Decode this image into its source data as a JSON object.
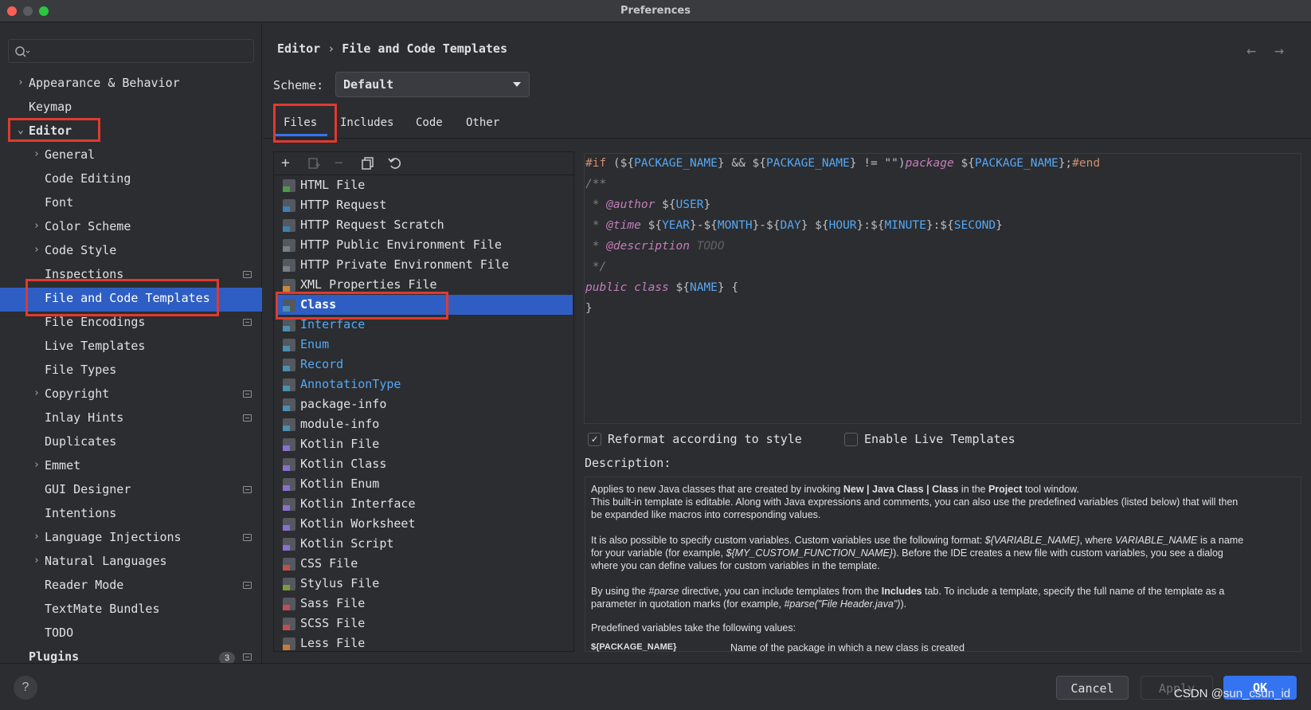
{
  "window": {
    "title": "Preferences"
  },
  "sidebar": {
    "search_placeholder": "",
    "items": [
      {
        "label": "Appearance & Behavior"
      },
      {
        "label": "Keymap"
      },
      {
        "label": "Editor"
      },
      {
        "label": "General"
      },
      {
        "label": "Code Editing"
      },
      {
        "label": "Font"
      },
      {
        "label": "Color Scheme"
      },
      {
        "label": "Code Style"
      },
      {
        "label": "Inspections"
      },
      {
        "label": "File and Code Templates"
      },
      {
        "label": "File Encodings"
      },
      {
        "label": "Live Templates"
      },
      {
        "label": "File Types"
      },
      {
        "label": "Copyright"
      },
      {
        "label": "Inlay Hints"
      },
      {
        "label": "Duplicates"
      },
      {
        "label": "Emmet"
      },
      {
        "label": "GUI Designer"
      },
      {
        "label": "Intentions"
      },
      {
        "label": "Language Injections"
      },
      {
        "label": "Natural Languages"
      },
      {
        "label": "Reader Mode"
      },
      {
        "label": "TextMate Bundles"
      },
      {
        "label": "TODO"
      },
      {
        "label": "Plugins"
      }
    ],
    "plugins_badge": "3"
  },
  "header": {
    "breadcrumb_parent": "Editor",
    "breadcrumb_sep": "›",
    "breadcrumb_current": "File and Code Templates"
  },
  "scheme": {
    "label": "Scheme:",
    "value": "Default"
  },
  "tabs": [
    {
      "label": "Files"
    },
    {
      "label": "Includes"
    },
    {
      "label": "Code"
    },
    {
      "label": "Other"
    }
  ],
  "templates": [
    {
      "label": "HTML File",
      "color": "#4b9a4b"
    },
    {
      "label": "HTTP Request",
      "color": "#3d7fb0"
    },
    {
      "label": "HTTP Request Scratch",
      "color": "#3d7fb0"
    },
    {
      "label": "HTTP Public Environment File",
      "color": "#7a7e85"
    },
    {
      "label": "HTTP Private Environment File",
      "color": "#7a7e85"
    },
    {
      "label": "XML Properties File",
      "color": "#c88a3a"
    },
    {
      "label": "Class",
      "color": "#4b8fb0"
    },
    {
      "label": "Interface",
      "color": "#4b8fb0"
    },
    {
      "label": "Enum",
      "color": "#4b8fb0"
    },
    {
      "label": "Record",
      "color": "#4b8fb0"
    },
    {
      "label": "AnnotationType",
      "color": "#4b8fb0"
    },
    {
      "label": "package-info",
      "color": "#4b8fb0"
    },
    {
      "label": "module-info",
      "color": "#4b8fb0"
    },
    {
      "label": "Kotlin File",
      "color": "#8a6fd0"
    },
    {
      "label": "Kotlin Class",
      "color": "#8a6fd0"
    },
    {
      "label": "Kotlin Enum",
      "color": "#8a6fd0"
    },
    {
      "label": "Kotlin Interface",
      "color": "#8a6fd0"
    },
    {
      "label": "Kotlin Worksheet",
      "color": "#8a6fd0"
    },
    {
      "label": "Kotlin Script",
      "color": "#8a6fd0"
    },
    {
      "label": "CSS File",
      "color": "#c0504d"
    },
    {
      "label": "Stylus File",
      "color": "#7f9a3a"
    },
    {
      "label": "Sass File",
      "color": "#c0504d"
    },
    {
      "label": "SCSS File",
      "color": "#c0504d"
    },
    {
      "label": "Less File",
      "color": "#c87a3a"
    }
  ],
  "code": {
    "l1_if": "#if",
    "l1_a": " (${",
    "l1_v1": "PACKAGE_NAME",
    "l1_b": "} && ${",
    "l1_v2": "PACKAGE_NAME",
    "l1_c": "} != \"\")",
    "l1_pkg": "package",
    "l1_d": " ${",
    "l1_v3": "PACKAGE_NAME",
    "l1_e": "};",
    "l1_end": "#end",
    "l2": "/**",
    "l3_star": " * ",
    "l3_tag": "@author",
    "l3_a": " ${",
    "l3_v": "USER",
    "l3_b": "}",
    "l4_star": " * ",
    "l4_tag": "@time",
    "l4_a": " ${",
    "l4_v1": "YEAR",
    "l4_b": "}-${",
    "l4_v2": "MONTH",
    "l4_c": "}-${",
    "l4_v3": "DAY",
    "l4_d": "} ${",
    "l4_v4": "HOUR",
    "l4_e": "}:${",
    "l4_v5": "MINUTE",
    "l4_f": "}:${",
    "l4_v6": "SECOND",
    "l4_g": "}",
    "l5_star": " * ",
    "l5_tag": "@description",
    "l5_todo": " TODO",
    "l6": " */",
    "l7_pub": "public class",
    "l7_a": " ${",
    "l7_v": "NAME",
    "l7_b": "} {",
    "l8": "}"
  },
  "options": {
    "reformat_label": "Reformat according to style",
    "reformat_checked": true,
    "live_label": "Enable Live Templates",
    "live_checked": false
  },
  "description": {
    "label": "Description:",
    "p1a": "Applies to new Java classes that are created by invoking ",
    "p1b": "New | Java Class | Class",
    "p1c": " in the ",
    "p1d": "Project",
    "p1e": " tool window.",
    "p2": "This built-in template is editable. Along with Java expressions and comments, you can also use the predefined variables (listed below) that will then",
    "p3": "be expanded like macros into corresponding values.",
    "p4a": "It is also possible to specify custom variables. Custom variables use the following format: ",
    "p4b": "${VARIABLE_NAME}",
    "p4c": ", where ",
    "p4d": "VARIABLE_NAME",
    "p4e": " is a name",
    "p5a": "for your variable (for example, ",
    "p5b": "${MY_CUSTOM_FUNCTION_NAME}",
    "p5c": "). Before the IDE creates a new file with custom variables, you see a dialog",
    "p6": "where you can define values for custom variables in the template.",
    "p7a": "By using the ",
    "p7b": "#parse",
    "p7c": " directive, you can include templates from the ",
    "p7d": "Includes",
    "p7e": " tab. To include a template, specify the full name of the template as a",
    "p8a": "parameter in quotation marks (for example, ",
    "p8b": "#parse(\"File Header.java\")",
    "p8c": ").",
    "p9": "Predefined variables take the following values:",
    "v1_name": "${PACKAGE_NAME}",
    "v1_desc": "Name of the package in which a new class is created"
  },
  "footer": {
    "help": "?",
    "cancel": "Cancel",
    "apply": "Apply",
    "ok": "OK",
    "watermark": "CSDN @sun_csdn_id"
  },
  "colors": {
    "accent": "#3574f0",
    "selection": "#2e5ec4",
    "annotation_box": "#e03a30"
  }
}
